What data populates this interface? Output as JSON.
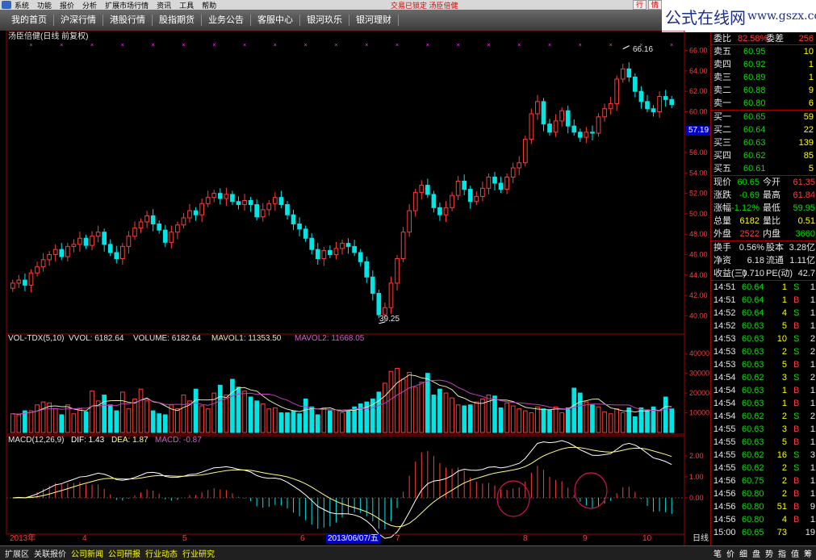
{
  "menu": {
    "items": [
      "系统",
      "功能",
      "报价",
      "分析",
      "扩展市场行情",
      "资讯",
      "工具",
      "帮助"
    ],
    "status": "交易已锁定   汤臣倍健",
    "controls": [
      "行",
      "情"
    ]
  },
  "tabs": [
    "我的首页",
    "沪深行情",
    "港股行情",
    "股指期货",
    "业务公告",
    "客服中心",
    "银河玖乐",
    "银河理财"
  ],
  "brand": {
    "cn": "公式在线网",
    "url": "www.gszx.com.cn"
  },
  "chart": {
    "title": "汤臣倍健(日线 前复权)",
    "price_axis": [
      "66.00",
      "64.00",
      "62.00",
      "60.00",
      "58.00",
      "56.00",
      "54.00",
      "52.00",
      "50.00",
      "48.00",
      "46.00",
      "44.00",
      "42.00",
      "40.00"
    ],
    "current_price_tag": "57.19",
    "high_label": "66.16",
    "low_label": "39.25",
    "vol_header": {
      "name": "VOL-TDX(5,10)",
      "vvol": "VVOL: 6182.64",
      "volume": "VOLUME: 6182.64",
      "mavol1": "MAVOL1: 11353.50",
      "mavol2": "MAVOL2: 11668.05"
    },
    "vol_axis": [
      "40000",
      "30000",
      "20000",
      "10000"
    ],
    "macd_header": {
      "name": "MACD(12,26,9)",
      "dif": "DIF: 1.43",
      "dea": "DEA: 1.87",
      "macd": "MACD: -0.87"
    },
    "macd_axis": [
      "2.00",
      "1.00",
      "0.00"
    ],
    "date_axis": {
      "year": "2013年",
      "m4": "4",
      "m5": "5",
      "m6": "6",
      "m7": "7",
      "m8": "8",
      "m9": "9",
      "m10": "10"
    },
    "cursor_date": "2013/06/07/五",
    "period": "日线",
    "colors": {
      "up": "#ff3c3c",
      "down": "#00e5e5",
      "ma1": "#e6e6b0",
      "ma2": "#c040c0",
      "dif": "#ffffff",
      "dea": "#ffff80"
    }
  },
  "chart_data": {
    "type": "candlestick",
    "title": "汤臣倍健(日线 前复权)",
    "ylim": [
      39,
      67
    ],
    "high": 66.16,
    "low": 39.25,
    "closes": [
      43.2,
      43.5,
      43.0,
      44.2,
      44.8,
      45.5,
      46.0,
      46.5,
      45.8,
      46.8,
      47.0,
      47.6,
      46.9,
      47.8,
      48.2,
      47.0,
      46.2,
      45.6,
      46.8,
      47.8,
      48.6,
      49.2,
      49.8,
      49.0,
      48.4,
      47.2,
      48.2,
      48.9,
      49.6,
      50.3,
      49.9,
      51.0,
      51.6,
      52.0,
      51.5,
      51.9,
      51.2,
      50.9,
      51.3,
      50.9,
      49.7,
      50.4,
      51.0,
      51.6,
      50.9,
      49.9,
      49.0,
      48.5,
      47.6,
      46.5,
      45.6,
      46.4,
      46.0,
      46.6,
      47.1,
      46.8,
      46.2,
      45.3,
      43.8,
      42.2,
      40.1,
      40.8,
      43.2,
      45.6,
      48.2,
      50.3,
      52.1,
      52.8,
      51.9,
      50.6,
      49.9,
      50.6,
      51.8,
      53.2,
      52.4,
      51.2,
      51.7,
      52.5,
      53.6,
      53.0,
      52.4,
      53.6,
      54.5,
      55.0,
      57.3,
      59.8,
      61.0,
      58.8,
      58.0,
      59.1,
      60.1,
      58.6,
      58.0,
      57.5,
      58.0,
      57.9,
      59.5,
      60.3,
      60.8,
      63.2,
      64.2,
      63.4,
      62.0,
      61.0,
      60.3,
      60.0,
      61.5,
      61.2,
      60.7
    ],
    "volumes": [
      9500,
      9000,
      11000,
      11000,
      14000,
      15500,
      15000,
      12000,
      9000,
      14000,
      9500,
      12000,
      10500,
      21000,
      16000,
      19000,
      14000,
      11000,
      20500,
      12000,
      17000,
      22000,
      16000,
      11000,
      9500,
      9000,
      14000,
      12000,
      19000,
      16000,
      22000,
      13500,
      12000,
      20000,
      24000,
      19000,
      27000,
      23000,
      21000,
      18000,
      16000,
      14500,
      12000,
      12500,
      10000,
      10000,
      11000,
      9500,
      17000,
      13000,
      9000,
      12500,
      11000,
      11500,
      10000,
      11000,
      13000,
      14500,
      15500,
      17000,
      20500,
      25000,
      31000,
      32500,
      27000,
      30500,
      23000,
      25500,
      30000,
      19000,
      22000,
      20000,
      17500,
      14000,
      13500,
      14000,
      15500,
      17000,
      19000,
      18500,
      12500,
      15000,
      13500,
      12000,
      11000,
      10000,
      13000,
      12000,
      11500,
      13000,
      10000,
      12500,
      22500,
      20000,
      15500,
      14000,
      13000,
      10500,
      9500,
      12000,
      10000,
      12500,
      8000,
      12500,
      11500,
      13000,
      11000,
      18000,
      12000
    ],
    "volume_axis": [
      10000,
      20000,
      30000,
      40000
    ],
    "macd_ylim": [
      -1.5,
      2.5
    ]
  },
  "panel": {
    "quote_top": {
      "label": "委比",
      "value": "82.58%",
      "label2": "委差",
      "value2": "256"
    },
    "asks": [
      {
        "label": "卖五",
        "price": "60.95",
        "vol": "10"
      },
      {
        "label": "卖四",
        "price": "60.92",
        "vol": "1"
      },
      {
        "label": "卖三",
        "price": "60.89",
        "vol": "1"
      },
      {
        "label": "卖二",
        "price": "60.88",
        "vol": "9"
      },
      {
        "label": "卖一",
        "price": "60.80",
        "vol": "6"
      }
    ],
    "bids": [
      {
        "label": "买一",
        "price": "60.65",
        "vol": "59"
      },
      {
        "label": "买二",
        "price": "60.64",
        "vol": "22"
      },
      {
        "label": "买三",
        "price": "60.63",
        "vol": "139"
      },
      {
        "label": "买四",
        "price": "60.62",
        "vol": "85"
      },
      {
        "label": "买五",
        "price": "60.61",
        "vol": "5"
      }
    ],
    "stats": [
      {
        "l1": "现价",
        "v1": "60.65",
        "l2": "今开",
        "v2": "61.35",
        "c1": "grn",
        "c2": "red"
      },
      {
        "l1": "涨跌",
        "v1": "-0.69",
        "l2": "最高",
        "v2": "61.84",
        "c1": "grn",
        "c2": "red"
      },
      {
        "l1": "涨幅",
        "v1": "-1.12%",
        "l2": "最低",
        "v2": "59.95",
        "c1": "grn",
        "c2": "grn"
      },
      {
        "l1": "总量",
        "v1": "6182",
        "l2": "量比",
        "v2": "0.51",
        "c1": "yel",
        "c2": "yel"
      },
      {
        "l1": "外盘",
        "v1": "2522",
        "l2": "内盘",
        "v2": "3660",
        "c1": "red",
        "c2": "grn"
      }
    ],
    "fin": [
      {
        "l1": "换手",
        "v1": "0.56%",
        "l2": "股本",
        "v2": "3.28亿"
      },
      {
        "l1": "净资",
        "v1": "6.18",
        "l2": "流通",
        "v2": "1.11亿"
      },
      {
        "l1": "收益(三)",
        "v1": "0.710",
        "l2": "PE(动)",
        "v2": "42.7"
      }
    ],
    "ticks": [
      {
        "t": "14:51",
        "p": "60.64",
        "v": "1",
        "d": "S",
        "n": "1"
      },
      {
        "t": "14:51",
        "p": "60.64",
        "v": "1",
        "d": "B",
        "n": "1"
      },
      {
        "t": "14:52",
        "p": "60.64",
        "v": "4",
        "d": "S",
        "n": "1"
      },
      {
        "t": "14:52",
        "p": "60.63",
        "v": "5",
        "d": "B",
        "n": "1"
      },
      {
        "t": "14:53",
        "p": "60.63",
        "v": "10",
        "d": "S",
        "n": "2"
      },
      {
        "t": "14:53",
        "p": "60.63",
        "v": "2",
        "d": "S",
        "n": "2"
      },
      {
        "t": "14:53",
        "p": "60.63",
        "v": "5",
        "d": "B",
        "n": "1"
      },
      {
        "t": "14:54",
        "p": "60.62",
        "v": "3",
        "d": "S",
        "n": "2"
      },
      {
        "t": "14:54",
        "p": "60.63",
        "v": "1",
        "d": "B",
        "n": "1"
      },
      {
        "t": "14:54",
        "p": "60.63",
        "v": "1",
        "d": "B",
        "n": "1"
      },
      {
        "t": "14:54",
        "p": "60.62",
        "v": "2",
        "d": "S",
        "n": "2"
      },
      {
        "t": "14:55",
        "p": "60.63",
        "v": "3",
        "d": "B",
        "n": "1"
      },
      {
        "t": "14:55",
        "p": "60.63",
        "v": "5",
        "d": "B",
        "n": "1"
      },
      {
        "t": "14:55",
        "p": "60.62",
        "v": "16",
        "d": "S",
        "n": "3"
      },
      {
        "t": "14:55",
        "p": "60.62",
        "v": "2",
        "d": "S",
        "n": "1"
      },
      {
        "t": "14:56",
        "p": "60.75",
        "v": "2",
        "d": "B",
        "n": "1"
      },
      {
        "t": "14:56",
        "p": "60.80",
        "v": "2",
        "d": "B",
        "n": "1"
      },
      {
        "t": "14:56",
        "p": "60.80",
        "v": "51",
        "d": "B",
        "n": "9"
      },
      {
        "t": "14:56",
        "p": "60.80",
        "v": "4",
        "d": "B",
        "n": "1"
      },
      {
        "t": "15:00",
        "p": "60.65",
        "v": "73",
        "d": "",
        "n": "19"
      }
    ]
  },
  "bottom": {
    "items": [
      "扩展区",
      "关联报价",
      "公司新闻",
      "公司研报",
      "行业动态",
      "行业研究"
    ],
    "right": [
      "笔",
      "价",
      "细",
      "盘",
      "势",
      "指",
      "值",
      "筹"
    ]
  }
}
